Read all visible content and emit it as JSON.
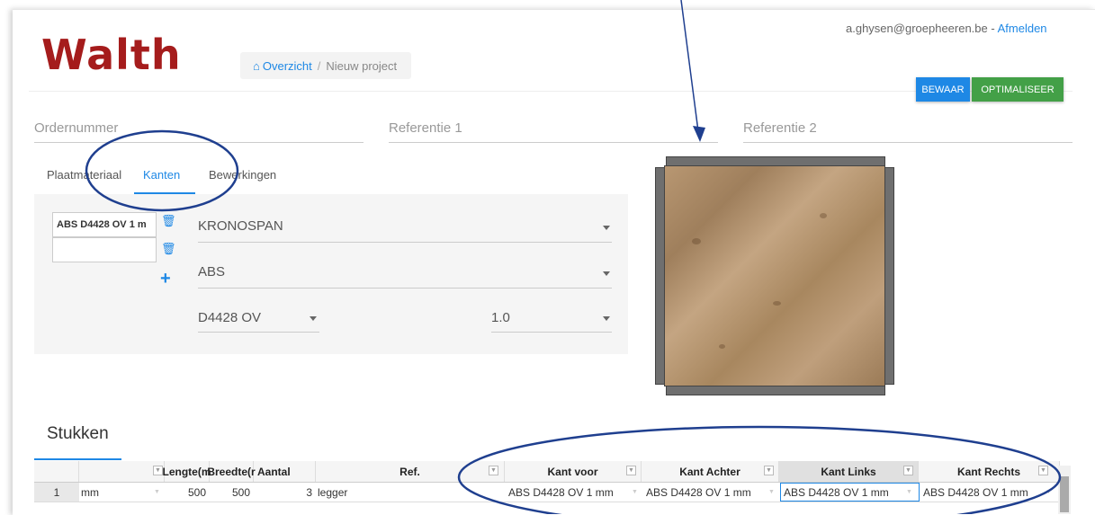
{
  "app": {
    "logo": "Walth",
    "breadcrumb": {
      "home": "Overzicht",
      "separator": "/",
      "current": "Nieuw project"
    },
    "user": {
      "email": "a.ghysen@groepheeren.be",
      "separator": " - ",
      "logout": "Afmelden"
    }
  },
  "toolbar": {
    "save_label": "BEWAAR",
    "optimize_label": "OPTIMALISEER"
  },
  "fields": {
    "order_number": "Ordernummer",
    "reference1": "Referentie 1",
    "reference2": "Referentie 2"
  },
  "tabs": [
    {
      "label": "Plaatmateriaal",
      "active": false
    },
    {
      "label": "Kanten",
      "active": true
    },
    {
      "label": "Bewerkingen",
      "active": false
    }
  ],
  "edges_panel": {
    "edge_list": [
      {
        "value": "ABS D4428 OV 1 m"
      },
      {
        "value": ""
      }
    ],
    "brand": "KRONOSPAN",
    "material": "ABS",
    "decor": "D4428 OV",
    "thickness": "1.0"
  },
  "pieces": {
    "title": "Stukken",
    "columns": [
      {
        "label": ""
      },
      {
        "label": "Lengte(m"
      },
      {
        "label": "Breedte(r"
      },
      {
        "label": "Aantal"
      },
      {
        "label": "Ref."
      },
      {
        "label": "Kant voor"
      },
      {
        "label": "Kant Achter"
      },
      {
        "label": "Kant Links"
      },
      {
        "label": "Kant Rechts"
      }
    ],
    "rows": [
      {
        "index": "1",
        "unit": "mm",
        "length": "500",
        "width": "500",
        "quantity": "3",
        "ref": "legger",
        "edge_front": "ABS D4428 OV 1 mm",
        "edge_back": "ABS D4428 OV 1 mm",
        "edge_left": "ABS D4428 OV 1 mm",
        "edge_right": "ABS D4428 OV 1 mm"
      }
    ]
  },
  "colors": {
    "accent": "#1e88e5",
    "success": "#43a047",
    "brand": "#a51c1c",
    "annotation": "#1f3f8f"
  }
}
